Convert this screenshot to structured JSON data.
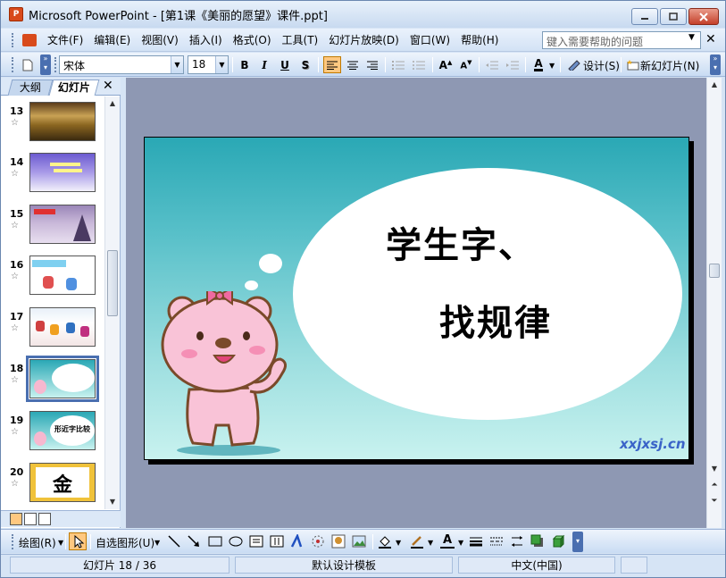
{
  "window": {
    "title": "Microsoft PowerPoint - [第1课《美丽的愿望》课件.ppt]",
    "app_icon_label": "P"
  },
  "menu": {
    "items": [
      "文件(F)",
      "编辑(E)",
      "视图(V)",
      "插入(I)",
      "格式(O)",
      "工具(T)",
      "幻灯片放映(D)",
      "窗口(W)",
      "帮助(H)"
    ],
    "help_placeholder": "键入需要帮助的问题"
  },
  "format_toolbar": {
    "font_name": "宋体",
    "font_size": "18",
    "bold": "B",
    "italic": "I",
    "underline": "U",
    "shadow": "S",
    "design_label": "设计(S)",
    "new_slide_label": "新幻灯片(N)"
  },
  "left_pane": {
    "tab_outline": "大纲",
    "tab_slides": "幻灯片",
    "slides": [
      {
        "num": "13"
      },
      {
        "num": "14"
      },
      {
        "num": "15"
      },
      {
        "num": "16"
      },
      {
        "num": "17"
      },
      {
        "num": "18",
        "selected": true
      },
      {
        "num": "19",
        "caption": "形近字比较"
      },
      {
        "num": "20",
        "caption": "金"
      }
    ]
  },
  "slide": {
    "line1": "学生字、",
    "line2": "找规律",
    "watermark": "xxjxsj.cn"
  },
  "draw_toolbar": {
    "draw_label": "绘图(R)",
    "autoshape_label": "自选图形(U)"
  },
  "status": {
    "slide_info": "幻灯片 18 / 36",
    "template": "默认设计模板",
    "language": "中文(中国)"
  },
  "colors": {
    "accent": "#ffc880",
    "slide_top": "#2aa8b5",
    "slide_bottom": "#c8f2ef",
    "workspace": "#8e98b3"
  }
}
